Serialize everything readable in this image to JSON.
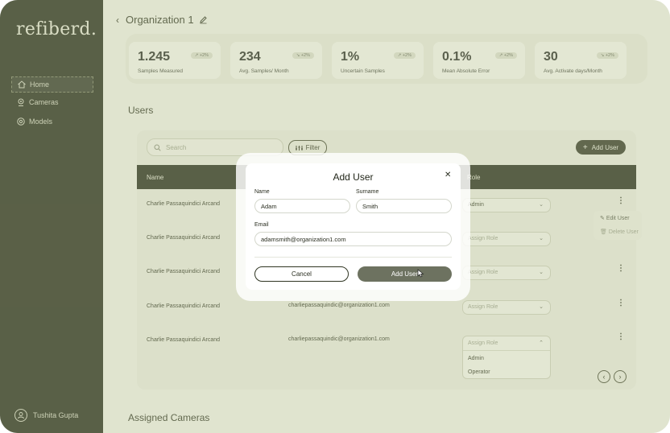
{
  "brand": {
    "logo_text": "refiberd."
  },
  "sidebar": {
    "items": [
      {
        "label": "Home",
        "icon": "home-icon",
        "active": true
      },
      {
        "label": "Cameras",
        "icon": "camera-icon",
        "active": false
      },
      {
        "label": "Models",
        "icon": "model-icon",
        "active": false
      }
    ],
    "user_name": "Tushita Gupta"
  },
  "header": {
    "title": "Organization 1"
  },
  "stats": [
    {
      "value": "1.245",
      "label": "Samples Measured",
      "change": "↗ +2%"
    },
    {
      "value": "234",
      "label": "Avg. Samples/ Month",
      "change": "↘ +2%"
    },
    {
      "value": "1%",
      "label": "Uncertain Samples",
      "change": "↗ +2%"
    },
    {
      "value": "0.1%",
      "label": "Mean Absolute Error",
      "change": "↗ +2%"
    },
    {
      "value": "30",
      "label": "Avg. Activate days/Month",
      "change": "↘ +2%"
    }
  ],
  "users_section": {
    "title": "Users",
    "search_placeholder": "Search",
    "filter_label": "Filter",
    "add_user_label": "Add User",
    "columns": {
      "name": "Name",
      "role": "Role"
    },
    "rows": [
      {
        "name": "Charlie Passaquindici Arcand",
        "email": "",
        "role": "Admin",
        "role_filled": true
      },
      {
        "name": "Charlie Passaquindici Arcand",
        "email": "",
        "role": "Assign Role",
        "role_filled": false
      },
      {
        "name": "Charlie Passaquindici Arcand",
        "email": "",
        "role": "Assign Role",
        "role_filled": false
      },
      {
        "name": "Charlie Passaquindici Arcand",
        "email": "charliepassaquindic@organization1.com",
        "role": "Assign Role",
        "role_filled": false
      },
      {
        "name": "Charlie Passaquindici Arcand",
        "email": "charliepassaquindic@organization1.com",
        "role": "Assign Role",
        "role_filled": false
      }
    ],
    "role_dropdown": {
      "placeholder": "Assign Role",
      "options": [
        "Admin",
        "Operator"
      ]
    },
    "context_menu": {
      "edit": "Edit User",
      "delete": "Delete User"
    }
  },
  "assigned_section": {
    "title": "Assigned Cameras"
  },
  "modal": {
    "title": "Add User",
    "name_label": "Name",
    "name_value": "Adam",
    "surname_label": "Surname",
    "surname_value": "Smith",
    "email_label": "Email",
    "email_value": "adamsmith@organization1.com",
    "cancel_label": "Cancel",
    "submit_label": "Add User"
  },
  "colors": {
    "sidebar_bg": "#2f3522",
    "accent_dark": "#3b412c",
    "primary_button": "#6d7260",
    "background": "#e9ecde"
  }
}
